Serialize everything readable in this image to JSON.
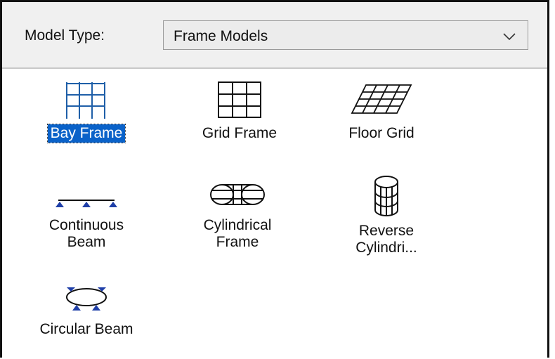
{
  "model_type": {
    "label": "Model Type:",
    "selected": "Frame Models"
  },
  "items": [
    {
      "label": "Bay Frame",
      "icon": "bay-frame-icon",
      "selected": true
    },
    {
      "label": "Grid Frame",
      "icon": "grid-frame-icon",
      "selected": false
    },
    {
      "label": "Floor Grid",
      "icon": "floor-grid-icon",
      "selected": false
    },
    {
      "label_line1": "Continuous",
      "label_line2": "Beam",
      "icon": "continuous-beam-icon",
      "selected": false
    },
    {
      "label_line1": "Cylindrical",
      "label_line2": "Frame",
      "icon": "cylindrical-frame-icon",
      "selected": false
    },
    {
      "label_line1": "Reverse",
      "label_line2": "Cylindri...",
      "icon": "reverse-cylindrical-icon",
      "selected": false
    },
    {
      "label": "Circular Beam",
      "icon": "circular-beam-icon",
      "selected": false
    }
  ],
  "colors": {
    "selection": "#0a62c9",
    "support": "#1f3fa8",
    "icon_blue": "#1f5fa8"
  }
}
